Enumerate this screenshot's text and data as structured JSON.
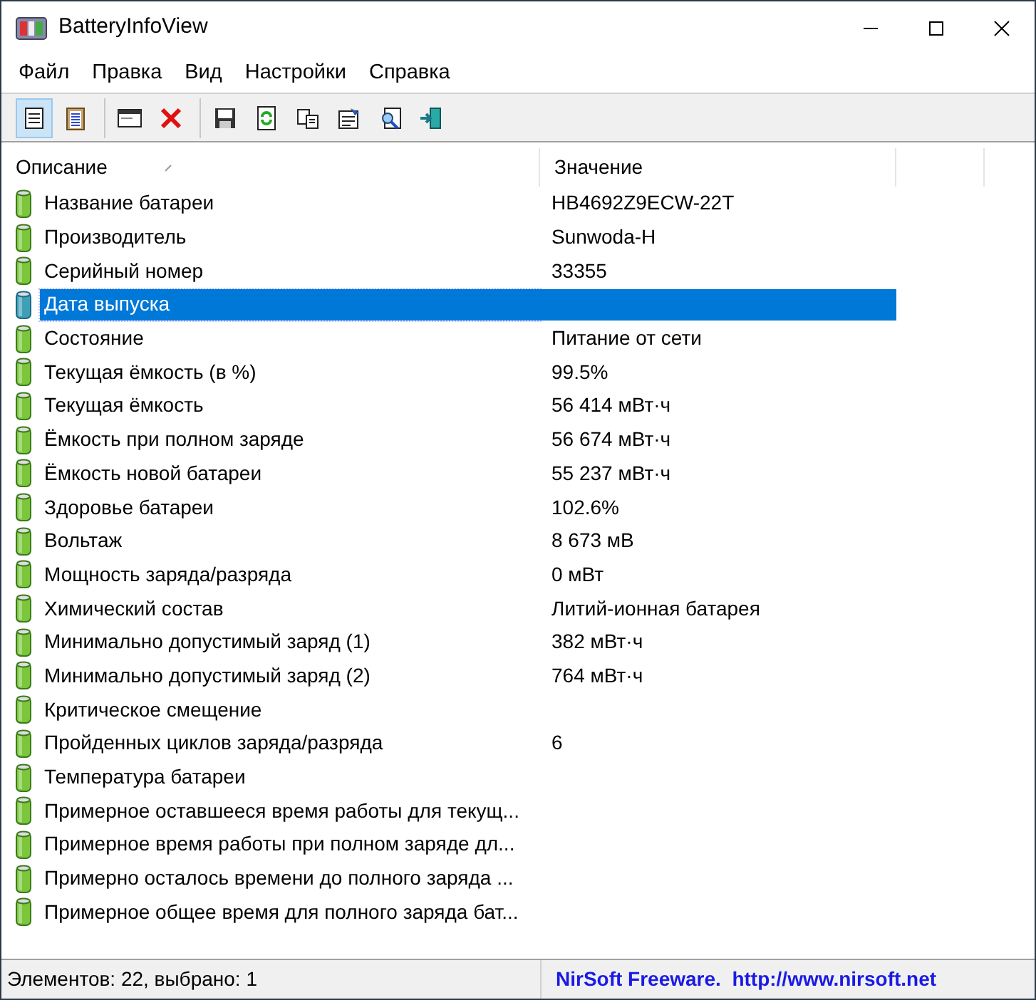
{
  "window": {
    "title": "BatteryInfoView"
  },
  "menu": [
    "Файл",
    "Правка",
    "Вид",
    "Настройки",
    "Справка"
  ],
  "toolbar": [
    [
      {
        "selected": true
      },
      {
        "selected": false
      }
    ],
    [
      {
        "selected": false
      },
      {
        "selected": false
      }
    ],
    [
      {
        "selected": false
      },
      {
        "selected": false
      },
      {
        "selected": false
      },
      {
        "selected": false
      },
      {
        "selected": false
      },
      {
        "selected": false
      }
    ]
  ],
  "table": {
    "columns": [
      "Описание",
      "Значение"
    ],
    "rows": [
      {
        "label": "Название батареи",
        "value": "HB4692Z9ECW-22T",
        "selected": false
      },
      {
        "label": "Производитель",
        "value": "Sunwoda-H",
        "selected": false
      },
      {
        "label": "Серийный номер",
        "value": "33355",
        "selected": false
      },
      {
        "label": "Дата выпуска",
        "value": "",
        "selected": true
      },
      {
        "label": "Состояние",
        "value": "Питание от сети",
        "selected": false
      },
      {
        "label": "Текущая ёмкость (в %)",
        "value": "99.5%",
        "selected": false
      },
      {
        "label": "Текущая ёмкость",
        "value": "56 414 мВт·ч",
        "selected": false
      },
      {
        "label": "Ёмкость при полном заряде",
        "value": "56 674 мВт·ч",
        "selected": false
      },
      {
        "label": "Ёмкость новой батареи",
        "value": "55 237 мВт·ч",
        "selected": false
      },
      {
        "label": "Здоровье батареи",
        "value": "102.6%",
        "selected": false
      },
      {
        "label": "Вольтаж",
        "value": "8 673 мВ",
        "selected": false
      },
      {
        "label": "Мощность заряда/разряда",
        "value": "0 мВт",
        "selected": false
      },
      {
        "label": "Химический состав",
        "value": "Литий-ионная батарея",
        "selected": false
      },
      {
        "label": "Минимально допустимый заряд (1)",
        "value": "382 мВт·ч",
        "selected": false
      },
      {
        "label": "Минимально допустимый заряд (2)",
        "value": "764 мВт·ч",
        "selected": false
      },
      {
        "label": "Критическое смещение",
        "value": "",
        "selected": false
      },
      {
        "label": "Пройденных циклов заряда/разряда",
        "value": "6",
        "selected": false
      },
      {
        "label": "Температура батареи",
        "value": "",
        "selected": false
      },
      {
        "label": "Примерное оставшееся время работы для текущ...",
        "value": "",
        "selected": false
      },
      {
        "label": "Примерное время работы при полном заряде дл...",
        "value": "",
        "selected": false
      },
      {
        "label": "Примерно осталось времени до полного заряда ...",
        "value": "",
        "selected": false
      },
      {
        "label": "Примерное общее время для полного заряда бат...",
        "value": "",
        "selected": false
      }
    ]
  },
  "status_bar": {
    "count": "Элементов: 22, выбрано: 1",
    "link": "NirSoft Freeware.  http://www.nirsoft.net"
  }
}
